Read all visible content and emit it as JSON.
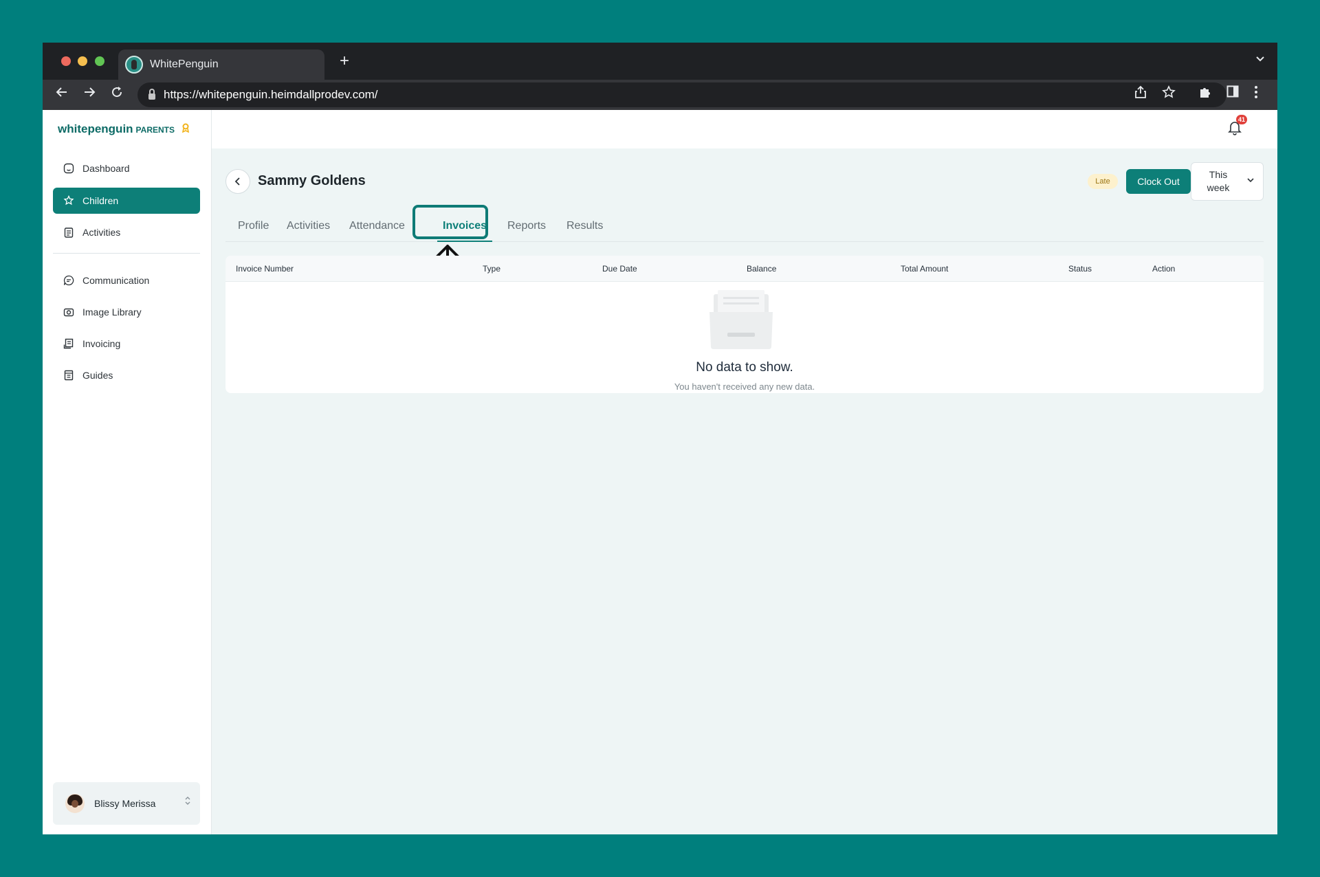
{
  "browser": {
    "tab_title": "WhitePenguin",
    "new_tab": "+",
    "url": "https://whitepenguin.heimdallprodev.com/"
  },
  "brand": {
    "logo_main": "whitepenguin",
    "logo_sub": "PARENTS"
  },
  "sidebar": {
    "items": [
      {
        "label": "Dashboard",
        "icon": "dashboard-icon"
      },
      {
        "label": "Children",
        "icon": "children-icon"
      },
      {
        "label": "Activities",
        "icon": "activities-icon"
      },
      {
        "label": "Communication",
        "icon": "chat-icon"
      },
      {
        "label": "Image Library",
        "icon": "camera-icon"
      },
      {
        "label": "Invoicing",
        "icon": "invoice-icon"
      },
      {
        "label": "Guides",
        "icon": "book-icon"
      }
    ],
    "active_item": "Children",
    "user": {
      "name": "Blissy Merissa"
    }
  },
  "topbar": {
    "notification_count": "41"
  },
  "header": {
    "child_name": "Sammy Goldens",
    "status_badge": "Late",
    "clock_out_label": "Clock Out",
    "range_line1": "This",
    "range_line2": "week"
  },
  "tabs": [
    {
      "label": "Profile"
    },
    {
      "label": "Activities"
    },
    {
      "label": "Attendance"
    },
    {
      "label": "Invoices"
    },
    {
      "label": "Reports"
    },
    {
      "label": "Results"
    }
  ],
  "active_tab": "Invoices",
  "table": {
    "columns": [
      "Invoice Number",
      "Type",
      "Due Date",
      "Balance",
      "Total Amount",
      "Status",
      "Action"
    ],
    "rows": [],
    "empty_title": "No data to show.",
    "empty_subtitle": "You haven't received any new data."
  },
  "colors": {
    "background": "#007f7d",
    "accent": "#0d7f78",
    "late_badge": "#fdf1cd",
    "notification_badge": "#e0413b"
  }
}
